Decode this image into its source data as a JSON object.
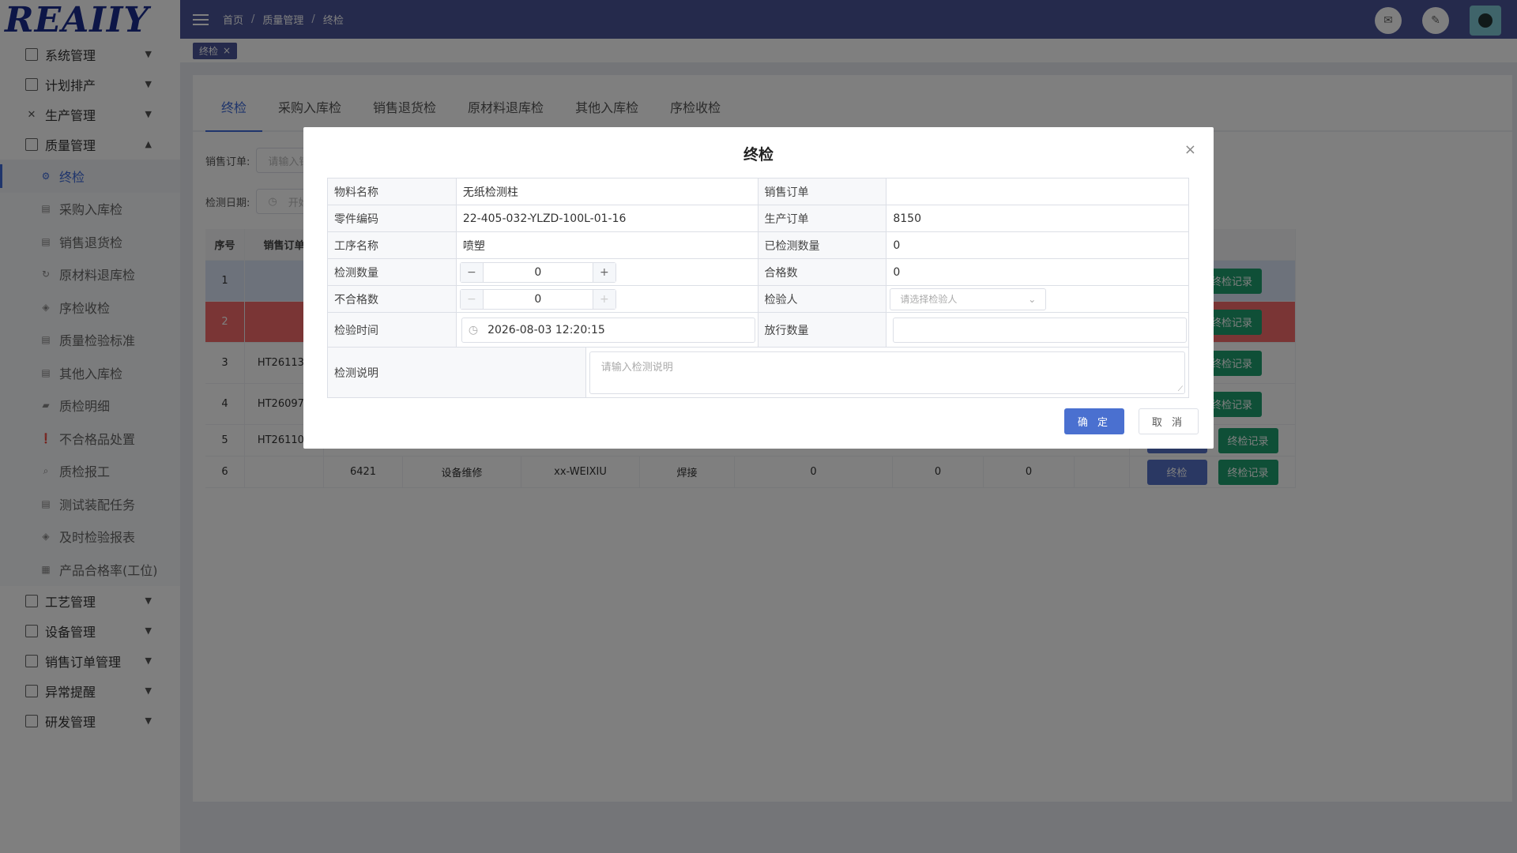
{
  "logo": {
    "text": "REAIIY"
  },
  "header": {
    "breadcrumb": [
      "首页",
      "质量管理",
      "终检"
    ]
  },
  "tagbar": {
    "tag_label": "终检",
    "tag_close": "×"
  },
  "sidebar": {
    "groups_top": [
      {
        "label": "系统管理",
        "icon": "monitor-icon"
      },
      {
        "label": "计划排产",
        "icon": "doc-icon"
      },
      {
        "label": "生产管理",
        "icon": "tools-icon"
      },
      {
        "label": "质量管理",
        "icon": "clipboard-icon"
      }
    ],
    "quality_items": [
      {
        "label": "终检",
        "active": true
      },
      {
        "label": "采购入库检"
      },
      {
        "label": "销售退货检"
      },
      {
        "label": "原材料退库检"
      },
      {
        "label": "序检收检"
      },
      {
        "label": "质量检验标准"
      },
      {
        "label": "其他入库检"
      },
      {
        "label": "质检明细"
      },
      {
        "label": "不合格品处置"
      },
      {
        "label": "质检报工"
      },
      {
        "label": "测试装配任务"
      },
      {
        "label": "及时检验报表"
      },
      {
        "label": "产品合格率(工位)"
      }
    ],
    "groups_bottom": [
      {
        "label": "工艺管理"
      },
      {
        "label": "设备管理"
      },
      {
        "label": "销售订单管理"
      },
      {
        "label": "异常提醒"
      },
      {
        "label": "研发管理"
      }
    ]
  },
  "tabs": [
    "终检",
    "采购入库检",
    "销售退货检",
    "原材料退库检",
    "其他入库检",
    "序检收检"
  ],
  "filters": {
    "sales_order_label": "销售订单:",
    "sales_order_placeholder": "请输入销售",
    "date_label": "检测日期:",
    "date_placeholder": "开始"
  },
  "table": {
    "headers": [
      "序号",
      "销售订单"
    ],
    "rows": [
      {
        "no": "1",
        "order": "",
        "c3": "",
        "c4": "",
        "c5": "",
        "c6": "",
        "c7": "",
        "c8": "",
        "c9": ""
      },
      {
        "no": "2",
        "order": "",
        "c3": "",
        "c4": "",
        "c5": "",
        "c6": "",
        "c7": "",
        "c8": "",
        "c9": ""
      },
      {
        "no": "3",
        "order": "HT261132",
        "c3": "",
        "c4": "",
        "c5": "",
        "c6": "",
        "c7": "",
        "c8": "",
        "c9": ""
      },
      {
        "no": "4",
        "order": "HT260975",
        "c3": "",
        "c4": "",
        "c5": "",
        "c6": "",
        "c7": "",
        "c8": "",
        "c9": ""
      },
      {
        "no": "5",
        "order": "HT261109",
        "c3": "",
        "c4": "",
        "c5": "",
        "c6": "",
        "c7": "",
        "c8": "",
        "c9": ""
      },
      {
        "no": "6",
        "order": "",
        "c3": "6421",
        "c4": "设备维修",
        "c5": "xx-WEIXIU",
        "c6": "焊接",
        "c7": "0",
        "c8": "0",
        "c9": "0"
      }
    ],
    "btn_inspect": "终检",
    "btn_record": "终检记录"
  },
  "dialog": {
    "title": "终检",
    "close": "×",
    "material_name_label": "物料名称",
    "material_name": "无纸检测柱",
    "sales_order_label": "销售订单",
    "sales_order": "",
    "part_code_label": "零件编码",
    "part_code": "22-405-032-YLZD-100L-01-16",
    "prod_order_label": "生产订单",
    "prod_order": "8150",
    "process_label": "工序名称",
    "process": "喷塑",
    "tested_qty_label": "已检测数量",
    "tested_qty": "0",
    "test_qty_label": "检测数量",
    "test_qty": "0",
    "pass_qty_label": "合格数",
    "pass_qty": "0",
    "fail_qty_label": "不合格数",
    "fail_qty": "0",
    "inspector_label": "检验人",
    "inspector_placeholder": "请选择检验人",
    "time_label": "检验时间",
    "time_value": "2026-08-03 12:20:15",
    "release_label": "放行数量",
    "desc_label": "检测说明",
    "desc_placeholder": "请输入检测说明",
    "ok": "确 定",
    "cancel": "取 消"
  }
}
